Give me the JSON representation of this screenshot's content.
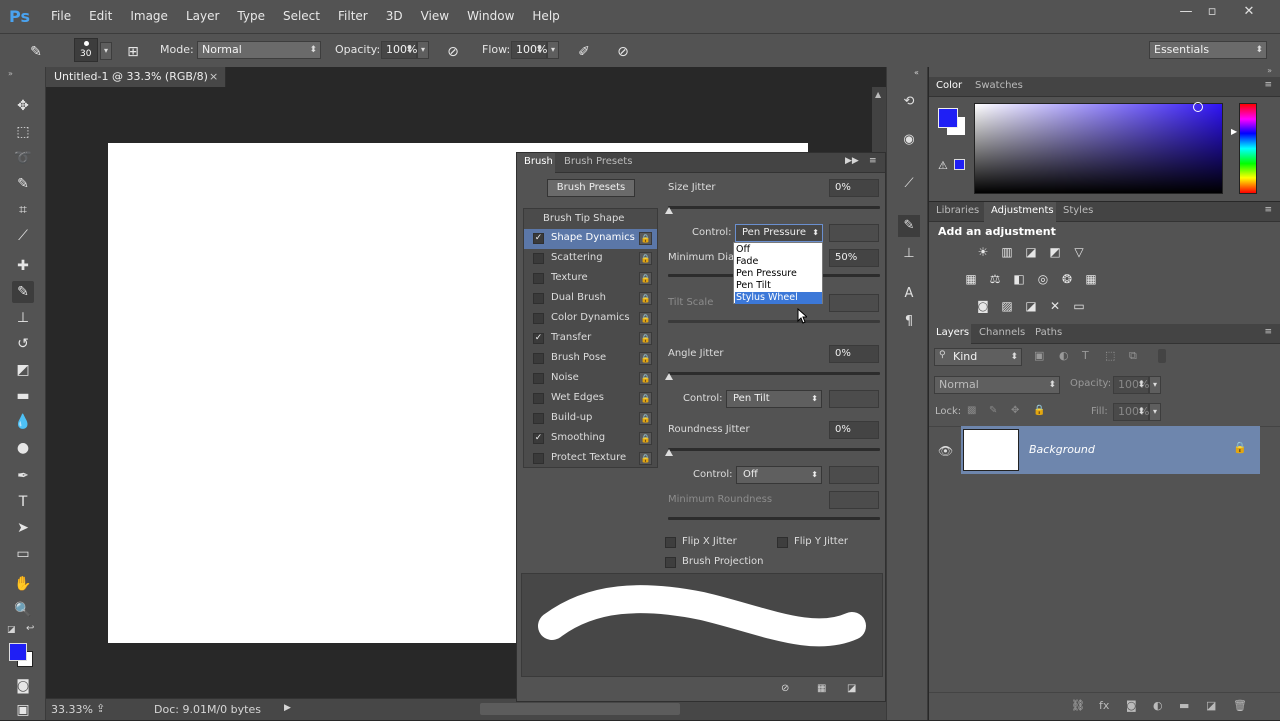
{
  "app": {
    "logo": "Ps",
    "menu": [
      "File",
      "Edit",
      "Image",
      "Layer",
      "Type",
      "Select",
      "Filter",
      "3D",
      "View",
      "Window",
      "Help"
    ],
    "window_controls": [
      "minimize",
      "maximize",
      "close"
    ]
  },
  "options_bar": {
    "brush_size": "30",
    "mode_label": "Mode:",
    "mode_value": "Normal",
    "opacity_label": "Opacity:",
    "opacity_value": "100%",
    "flow_label": "Flow:",
    "flow_value": "100%",
    "workspace": "Essentials"
  },
  "document": {
    "tab_title": "Untitled-1 @ 33.3% (RGB/8)",
    "tab_close": "×",
    "zoom": "33.33%",
    "doc_info": "Doc: 9.01M/0 bytes"
  },
  "brush_panel": {
    "tabs": [
      "Brush",
      "Brush Presets"
    ],
    "presets_button": "Brush Presets",
    "tip_shape": "Brush Tip Shape",
    "items": [
      {
        "label": "Shape Dynamics",
        "checked": true,
        "selected": true
      },
      {
        "label": "Scattering",
        "checked": false
      },
      {
        "label": "Texture",
        "checked": false
      },
      {
        "label": "Dual Brush",
        "checked": false
      },
      {
        "label": "Color Dynamics",
        "checked": false
      },
      {
        "label": "Transfer",
        "checked": true
      },
      {
        "label": "Brush Pose",
        "checked": false
      },
      {
        "label": "Noise",
        "checked": false
      },
      {
        "label": "Wet Edges",
        "checked": false
      },
      {
        "label": "Build-up",
        "checked": false
      },
      {
        "label": "Smoothing",
        "checked": true
      },
      {
        "label": "Protect Texture",
        "checked": false
      }
    ],
    "size_jitter_label": "Size Jitter",
    "size_jitter_value": "0%",
    "control_label": "Control:",
    "control1_value": "Pen Pressure",
    "min_diameter_label": "Minimum Diam",
    "min_diameter_value": "50%",
    "tilt_scale_label": "Tilt Scale",
    "angle_jitter_label": "Angle Jitter",
    "angle_jitter_value": "0%",
    "control2_value": "Pen Tilt",
    "roundness_jitter_label": "Roundness Jitter",
    "roundness_jitter_value": "0%",
    "control3_value": "Off",
    "min_roundness_label": "Minimum Roundness",
    "flip_x": "Flip X Jitter",
    "flip_y": "Flip Y Jitter",
    "brush_projection": "Brush Projection",
    "dropdown_options": [
      "Off",
      "Fade",
      "Pen Pressure",
      "Pen Tilt",
      "Stylus Wheel"
    ]
  },
  "color_panel": {
    "tabs": [
      "Color",
      "Swatches"
    ],
    "foreground": "#1f1ff5"
  },
  "adjustments_panel": {
    "tabs": [
      "Libraries",
      "Adjustments",
      "Styles"
    ],
    "title": "Add an adjustment"
  },
  "layers_panel": {
    "tabs": [
      "Layers",
      "Channels",
      "Paths"
    ],
    "filter": "Kind",
    "blend_mode": "Normal",
    "opacity_label": "Opacity:",
    "opacity_value": "100%",
    "lock_label": "Lock:",
    "fill_label": "Fill:",
    "fill_value": "100%",
    "layer_name": "Background"
  }
}
